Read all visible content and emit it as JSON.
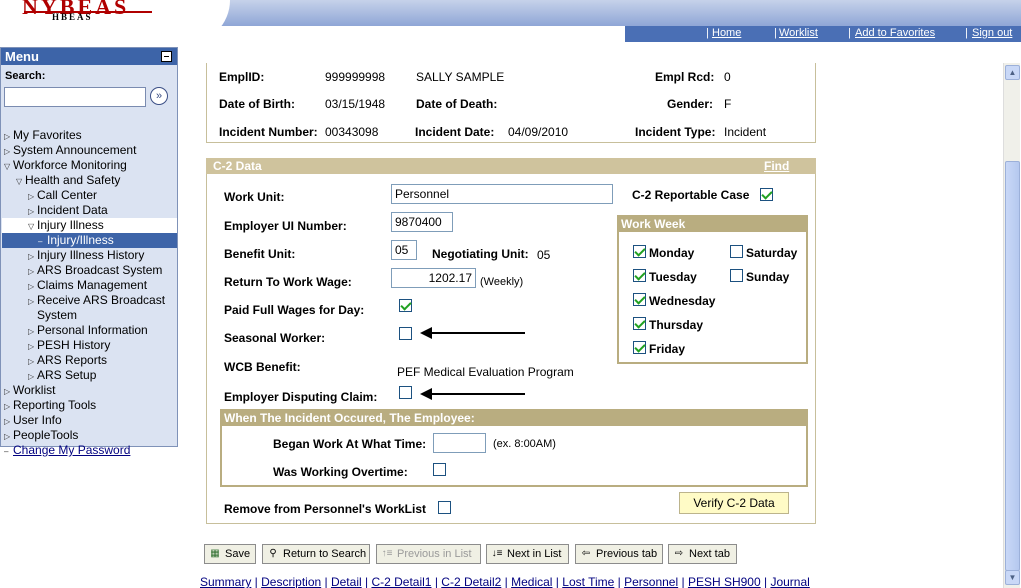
{
  "header": {
    "logo_main": "NYBEAS",
    "logo_sub": "HBEAS",
    "nav": [
      "Home",
      "Worklist",
      "Add to Favorites",
      "Sign out"
    ]
  },
  "menu": {
    "title": "Menu",
    "search_label": "Search:",
    "search_value": "",
    "go_icon": "double-chevron-right-icon",
    "items": [
      {
        "label": "My Favorites",
        "arrow": "right"
      },
      {
        "label": "System Announcement",
        "arrow": "right"
      },
      {
        "label": "Workforce Monitoring",
        "arrow": "down"
      },
      {
        "label": "Health and Safety",
        "arrow": "down"
      },
      {
        "label": "Call Center",
        "arrow": "right"
      },
      {
        "label": "Incident Data",
        "arrow": "right"
      },
      {
        "label": "Injury Illness",
        "arrow": "down"
      },
      {
        "label": "Injury/Illness",
        "arrow": "dash"
      },
      {
        "label": "Injury Illness History",
        "arrow": "right"
      },
      {
        "label": "ARS Broadcast System",
        "arrow": "right"
      },
      {
        "label": "Claims Management",
        "arrow": "right"
      },
      {
        "label": "Receive ARS Broadcast",
        "arrow": "right"
      },
      {
        "label": "System",
        "arrow": "none"
      },
      {
        "label": "Personal Information",
        "arrow": "right"
      },
      {
        "label": "PESH History",
        "arrow": "right"
      },
      {
        "label": "ARS Reports",
        "arrow": "right"
      },
      {
        "label": "ARS Setup",
        "arrow": "right"
      },
      {
        "label": "Worklist",
        "arrow": "right"
      },
      {
        "label": "Reporting Tools",
        "arrow": "right"
      },
      {
        "label": "User Info",
        "arrow": "right"
      },
      {
        "label": "PeopleTools",
        "arrow": "right"
      },
      {
        "label": "Change My Password",
        "arrow": "dash"
      }
    ]
  },
  "employee": {
    "emplid_label": "EmplID:",
    "emplid": "999999998",
    "name": "SALLY SAMPLE",
    "empl_rcd_label": "Empl Rcd:",
    "empl_rcd": "0",
    "dob_label": "Date of Birth:",
    "dob": "03/15/1948",
    "dod_label": "Date of Death:",
    "dod": "",
    "gender_label": "Gender:",
    "gender": "F",
    "incident_number_label": "Incident Number:",
    "incident_number": "00343098",
    "incident_date_label": "Incident Date:",
    "incident_date": "04/09/2010",
    "incident_type_label": "Incident Type:",
    "incident_type": "Incident"
  },
  "c2": {
    "section_title": "C-2 Data",
    "find_label": "Find",
    "work_unit_label": "Work Unit:",
    "work_unit": "Personnel",
    "c2_reportable_label": "C-2 Reportable Case",
    "c2_reportable": true,
    "employer_ui_label": "Employer UI Number:",
    "employer_ui": "9870400",
    "benefit_unit_label": "Benefit Unit:",
    "benefit_unit": "05",
    "negotiating_unit_label": "Negotiating Unit:",
    "negotiating_unit": "05",
    "rtw_wage_label": "Return To Work Wage:",
    "rtw_wage": "1202.17",
    "rtw_wage_unit": "(Weekly)",
    "paid_full_label": "Paid Full Wages for Day:",
    "paid_full": true,
    "seasonal_label": "Seasonal Worker:",
    "seasonal": false,
    "wcb_label": "WCB Benefit:",
    "wcb_value": "PEF Medical Evaluation Program",
    "disputing_label": "Employer Disputing Claim:",
    "disputing": false,
    "remove_label": "Remove from Personnel's WorkList",
    "remove": false,
    "verify_label": "Verify C-2 Data"
  },
  "work_week": {
    "title": "Work Week",
    "monday": "Monday",
    "monday_on": true,
    "tuesday": "Tuesday",
    "tuesday_on": true,
    "wednesday": "Wednesday",
    "wednesday_on": true,
    "thursday": "Thursday",
    "thursday_on": true,
    "friday": "Friday",
    "friday_on": true,
    "saturday": "Saturday",
    "saturday_on": false,
    "sunday": "Sunday",
    "sunday_on": false
  },
  "incident": {
    "title": "When The Incident Occured, The Employee:",
    "began_label": "Began Work At What Time:",
    "began_value": "",
    "began_hint": "(ex. 8:00AM)",
    "overtime_label": "Was Working Overtime:",
    "overtime": false
  },
  "toolbar": {
    "save": "Save",
    "return": "Return to Search",
    "prev_list": "Previous in List",
    "next_list": "Next in List",
    "prev_tab": "Previous tab",
    "next_tab": "Next tab"
  },
  "tabs": [
    "Summary",
    "Description",
    "Detail",
    "C-2 Detail1",
    "C-2 Detail2",
    "Medical",
    "Lost Time",
    "Personnel",
    "PESH SH900",
    "Journal"
  ]
}
